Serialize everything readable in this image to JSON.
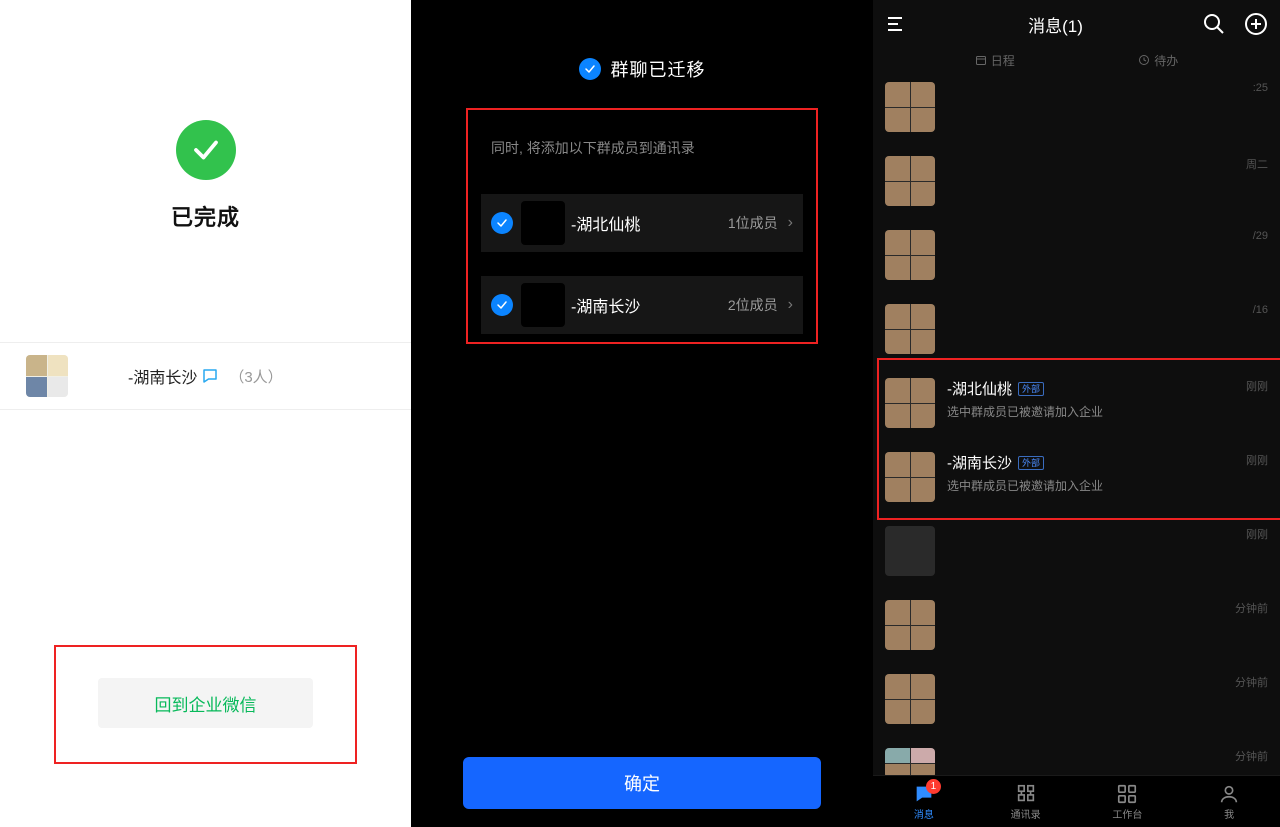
{
  "panel1": {
    "done_title": "已完成",
    "group_name": "-湖南长沙",
    "group_count": "（3人）",
    "return_btn": "回到企业微信"
  },
  "panel2": {
    "migrated_title": "群聊已迁移",
    "hint": "同时, 将添加以下群成员到通讯录",
    "rows": [
      {
        "loc": "-湖北仙桃",
        "count": "1位成员"
      },
      {
        "loc": "-湖南长沙",
        "count": "2位成员"
      }
    ],
    "confirm": "确定"
  },
  "panel3": {
    "header_title": "消息(1)",
    "top_tabs": {
      "left": "日程",
      "right": "待办"
    },
    "times": {
      "t0": ":25",
      "t1": "周二",
      "t2": "/29",
      "t3": "/16",
      "t4": "刚刚",
      "t5": "刚刚",
      "t6": "刚刚",
      "t7": "分钟前",
      "t8": "分钟前",
      "t9": "分钟前"
    },
    "highlight": [
      {
        "title": "-湖北仙桃",
        "badge": "外部",
        "sub": "选中群成员已被邀请加入企业",
        "time": "刚刚"
      },
      {
        "title": "-湖南长沙",
        "badge": "外部",
        "sub": "选中群成员已被邀请加入企业",
        "time": "刚刚"
      }
    ],
    "tabbar": {
      "messages": "消息",
      "contacts": "通讯录",
      "workbench": "工作台",
      "me": "我",
      "badge": "1"
    }
  }
}
